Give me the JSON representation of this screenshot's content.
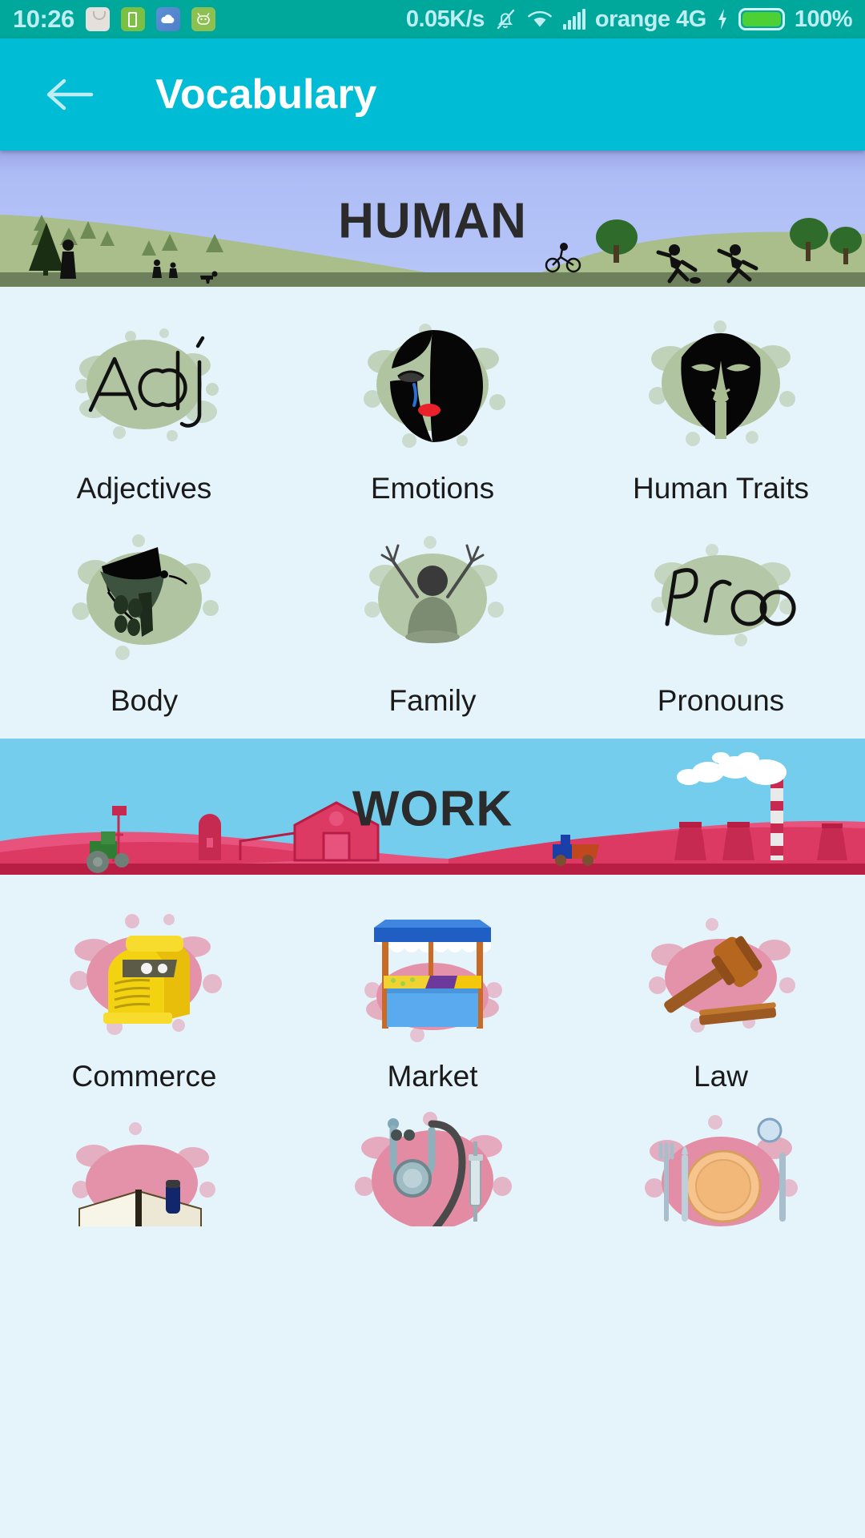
{
  "status_bar": {
    "time": "10:26",
    "network_speed": "0.05K/s",
    "carrier": "orange 4G",
    "battery_percent": "100%",
    "icons": [
      {
        "name": "shopping-bag-icon"
      },
      {
        "name": "battery-saver-icon"
      },
      {
        "name": "cloud-sync-icon"
      },
      {
        "name": "android-app-icon"
      },
      {
        "name": "mute-bell-icon"
      },
      {
        "name": "wifi-icon"
      },
      {
        "name": "signal-bars-icon"
      },
      {
        "name": "charging-bolt-icon"
      },
      {
        "name": "battery-icon"
      }
    ]
  },
  "app_bar": {
    "back_icon": "arrow-left-icon",
    "title": "Vocabulary",
    "background": "#00BCD4"
  },
  "sections": [
    {
      "id": "human",
      "banner_title": "HUMAN",
      "banner_theme": {
        "sky": "#AEC0F5",
        "hill_light": "#A9BE8B",
        "hill_dark": "#6E7F5B",
        "accent": "#1E1E1E"
      },
      "items": [
        {
          "label": "Adjectives",
          "icon": "adj-handwriting-icon"
        },
        {
          "label": "Emotions",
          "icon": "crying-face-icon"
        },
        {
          "label": "Human Traits",
          "icon": "face-mask-icon"
        },
        {
          "label": "Body",
          "icon": "human-torso-icon"
        },
        {
          "label": "Family",
          "icon": "family-figure-icon"
        },
        {
          "label": "Pronouns",
          "icon": "pro-handwriting-icon"
        }
      ]
    },
    {
      "id": "work",
      "banner_title": "WORK",
      "banner_theme": {
        "sky": "#74CDEC",
        "hill_light": "#E8537E",
        "hill_mid": "#DD3A63",
        "hill_dark": "#B81D44",
        "accent": "#C72A50"
      },
      "items": [
        {
          "label": "Commerce",
          "icon": "cash-register-icon"
        },
        {
          "label": "Market",
          "icon": "market-stall-icon"
        },
        {
          "label": "Law",
          "icon": "gavel-icon"
        }
      ],
      "partial_items": [
        {
          "label": "",
          "icon": "open-book-icon"
        },
        {
          "label": "",
          "icon": "stethoscope-icon"
        },
        {
          "label": "",
          "icon": "plate-cutlery-icon"
        }
      ]
    }
  ],
  "colors": {
    "page_background": "#E5F4FB",
    "status_bar": "#00A79B",
    "app_bar": "#00BCD4",
    "label_text": "#1A1A1A",
    "splatter_green": "#A9BC92",
    "splatter_pink": "#E4718F"
  }
}
